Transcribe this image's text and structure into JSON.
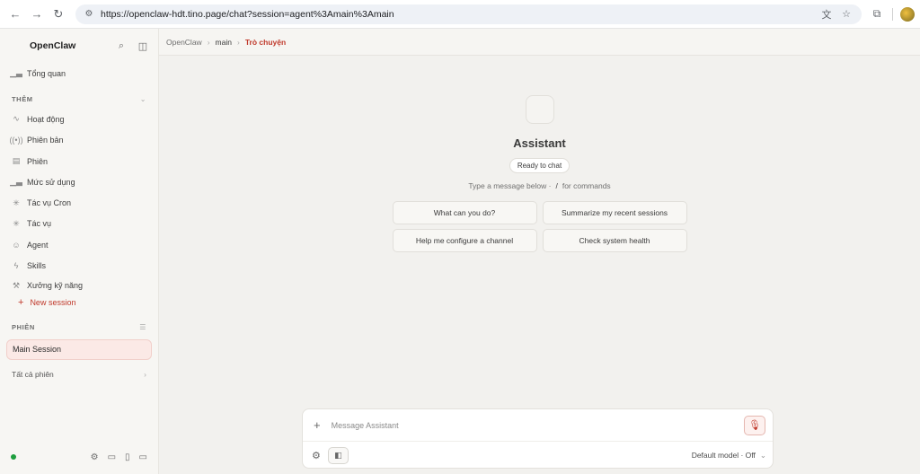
{
  "browser": {
    "url": "https://openclaw-hdt.tino.page/chat?session=agent%3Amain%3Amain"
  },
  "sidebar": {
    "brand": "OpenClaw",
    "overview": "Tổng quan",
    "section_more": "THÊM",
    "items": [
      {
        "label": "Hoạt động",
        "icon": "activity-icon"
      },
      {
        "label": "Phiên bản",
        "icon": "broadcast-icon"
      },
      {
        "label": "Phiên",
        "icon": "document-icon"
      },
      {
        "label": "Mức sử dụng",
        "icon": "bar-chart-icon"
      },
      {
        "label": "Tác vụ Cron",
        "icon": "loader-icon"
      },
      {
        "label": "Tác vụ",
        "icon": "loader-icon"
      },
      {
        "label": "Agent",
        "icon": "robot-icon"
      },
      {
        "label": "Skills",
        "icon": "bolt-icon"
      },
      {
        "label": "Xưởng kỹ năng",
        "icon": "tool-icon"
      }
    ],
    "new_session": "New session",
    "section_sessions": "PHIÊN",
    "active_session": "Main Session",
    "all_sessions": "Tất cả phiên"
  },
  "breadcrumb": {
    "root": "OpenClaw",
    "mid": "main",
    "current": "Trò chuyện"
  },
  "chat": {
    "title": "Assistant",
    "status": "Ready to chat",
    "hint_prefix": "Type a message below ·",
    "hint_key": "/",
    "hint_suffix": "for commands",
    "suggestions": [
      "What can you do?",
      "Summarize my recent sessions",
      "Help me configure a channel",
      "Check system health"
    ]
  },
  "composer": {
    "placeholder": "Message Assistant",
    "model": "Default model · Off"
  },
  "colors": {
    "accent": "#c0392b",
    "status_online": "#1e9e3e"
  }
}
